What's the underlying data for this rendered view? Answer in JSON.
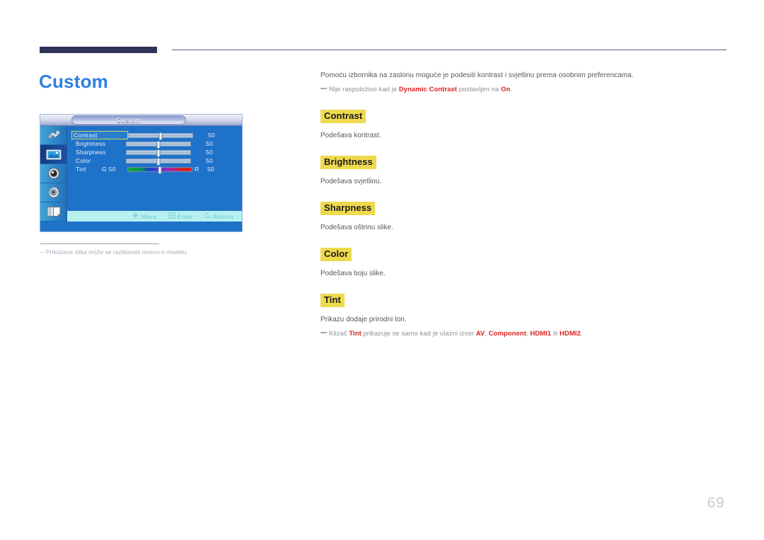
{
  "page": {
    "title": "Custom",
    "number": "69"
  },
  "osd": {
    "title": "Custom",
    "sidebar_icons": [
      {
        "name": "input-source-icon",
        "selected": false
      },
      {
        "name": "picture-icon",
        "selected": true
      },
      {
        "name": "sound-speaker-icon",
        "selected": false
      },
      {
        "name": "setup-gear-icon",
        "selected": false
      },
      {
        "name": "multi-control-pages-icon",
        "selected": false
      }
    ],
    "rows": [
      {
        "label": "Contrast",
        "value": "50",
        "selected": true,
        "type": "slider",
        "knob": 50
      },
      {
        "label": "Brightness",
        "value": "50",
        "selected": false,
        "type": "slider",
        "knob": 50
      },
      {
        "label": "Sharpness",
        "value": "50",
        "selected": false,
        "type": "slider",
        "knob": 50
      },
      {
        "label": "Color",
        "value": "50",
        "selected": false,
        "type": "slider",
        "knob": 50
      },
      {
        "label": "Tint",
        "value": "50",
        "selected": false,
        "type": "tint",
        "left_label": "G  50",
        "right_label": "R",
        "knob": 50
      }
    ],
    "footer": [
      {
        "icon": "move-dpad-icon",
        "label": "Move"
      },
      {
        "icon": "enter-key-icon",
        "label": "Enter"
      },
      {
        "icon": "return-arrow-icon",
        "label": "Return"
      }
    ]
  },
  "left_note": {
    "dash": "–",
    "text": "Prikazana slika može se razlikovati ovisno o modelu."
  },
  "content": {
    "intro": "Pomoću izbornika na zaslonu moguće je podesiti kontrast i svjetlinu prema osobnim preferencama.",
    "intro_note": {
      "before": "Nije raspoloživo kad je ",
      "accent1": "Dynamic Contrast",
      "middle": " postavljen na ",
      "accent2": "On",
      "after": "."
    },
    "sections": [
      {
        "term": "Contrast",
        "desc": "Podešava kontrast."
      },
      {
        "term": "Brightness",
        "desc": "Podešava svjetlinu."
      },
      {
        "term": "Sharpness",
        "desc": "Podešava oštrinu slike."
      },
      {
        "term": "Color",
        "desc": "Podešava boju slike."
      },
      {
        "term": "Tint",
        "desc": "Prikazu dodaje prirodni ton."
      }
    ],
    "tint_note": {
      "before": "Klizač ",
      "accent1": "Tint",
      "middle": " prikazuje se samo kad je ulazni izvor ",
      "accent2": "AV",
      "sep1": ", ",
      "accent3": "Component",
      "sep2": ", ",
      "accent4": "HDMI1",
      "sep3": " ili ",
      "accent5": "HDMI2",
      "after": "."
    }
  },
  "colors": {
    "title_blue": "#2f7fe0",
    "rule_navy": "#2e3357",
    "highlight_yellow": "#efd94e",
    "accent_red": "#dc2222",
    "osd_blue": "#1f72c9",
    "osd_footer_cyan": "#b8f0f0",
    "selected_outline": "#c9d861"
  }
}
